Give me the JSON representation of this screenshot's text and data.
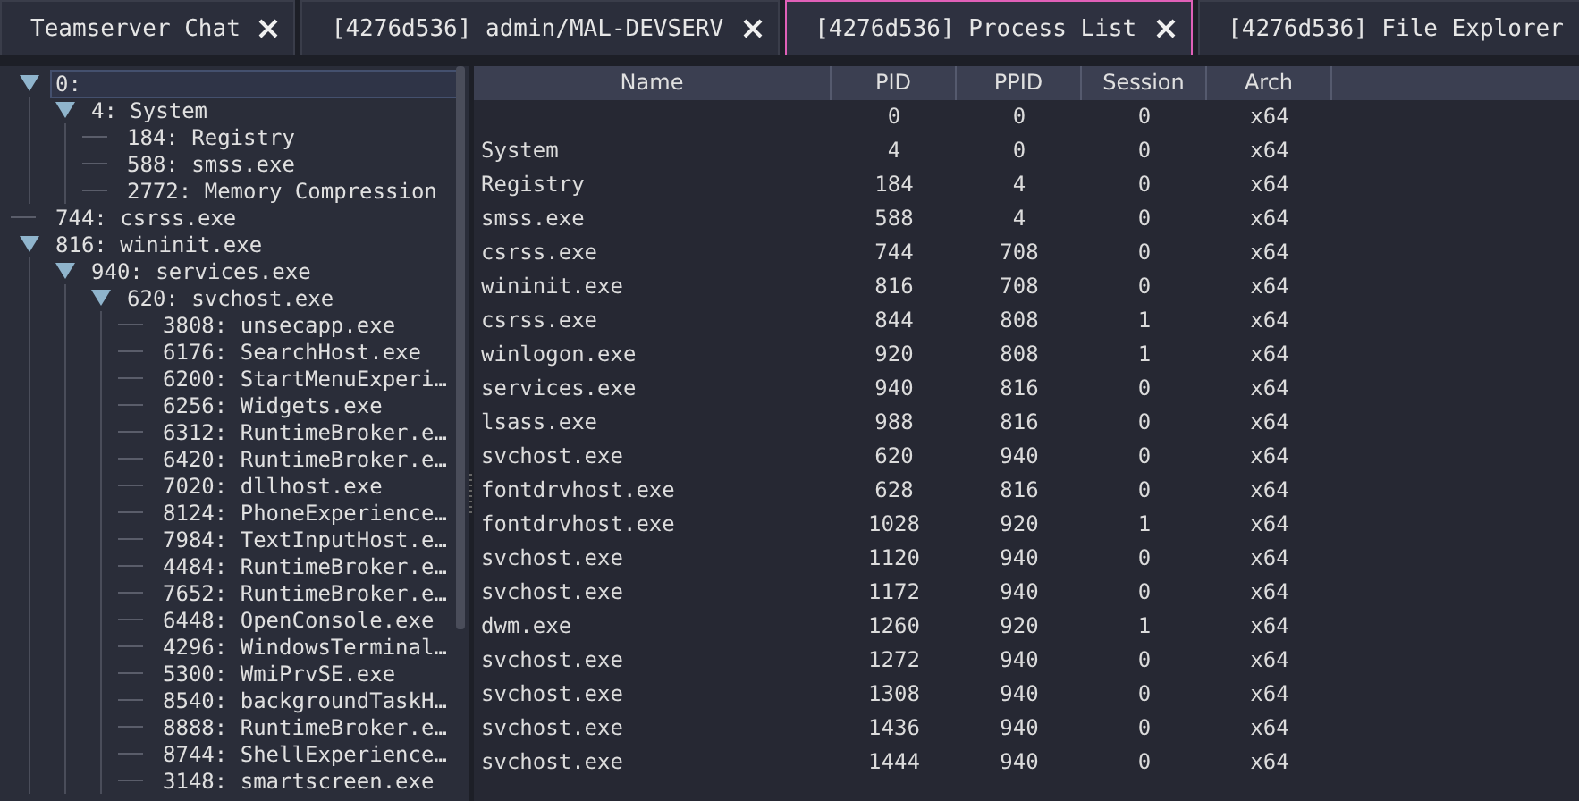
{
  "tabs": [
    {
      "label": "Teamserver Chat",
      "selected": false
    },
    {
      "label": "[4276d536] admin/MAL-DEVSERV",
      "selected": false
    },
    {
      "label": "[4276d536] Process List",
      "selected": true
    },
    {
      "label": "[4276d536] File Explorer",
      "selected": false
    }
  ],
  "process_tree": [
    {
      "label": "0:",
      "selected": true,
      "expanded": true,
      "children": [
        {
          "label": "4: System",
          "selected": false,
          "expanded": true,
          "children": [
            {
              "label": "184: Registry",
              "selected": false
            },
            {
              "label": "588: smss.exe",
              "selected": false
            },
            {
              "label": "2772: Memory Compression",
              "selected": false
            }
          ]
        }
      ]
    },
    {
      "label": "744: csrss.exe",
      "selected": false
    },
    {
      "label": "816: wininit.exe",
      "selected": false,
      "expanded": true,
      "children": [
        {
          "label": "940: services.exe",
          "selected": false,
          "expanded": true,
          "children": [
            {
              "label": "620: svchost.exe",
              "selected": false,
              "expanded": true,
              "children": [
                {
                  "label": "3808: unsecapp.exe",
                  "selected": false
                },
                {
                  "label": "6176: SearchHost.exe",
                  "selected": false
                },
                {
                  "label": "6200: StartMenuExperi…",
                  "selected": false
                },
                {
                  "label": "6256: Widgets.exe",
                  "selected": false
                },
                {
                  "label": "6312: RuntimeBroker.e…",
                  "selected": false
                },
                {
                  "label": "6420: RuntimeBroker.e…",
                  "selected": false
                },
                {
                  "label": "7020: dllhost.exe",
                  "selected": false
                },
                {
                  "label": "8124: PhoneExperience…",
                  "selected": false
                },
                {
                  "label": "7984: TextInputHost.e…",
                  "selected": false
                },
                {
                  "label": "4484: RuntimeBroker.e…",
                  "selected": false
                },
                {
                  "label": "7652: RuntimeBroker.e…",
                  "selected": false
                },
                {
                  "label": "6448: OpenConsole.exe",
                  "selected": false
                },
                {
                  "label": "4296: WindowsTerminal…",
                  "selected": false
                },
                {
                  "label": "5300: WmiPrvSE.exe",
                  "selected": false
                },
                {
                  "label": "8540: backgroundTaskH…",
                  "selected": false
                },
                {
                  "label": "8888: RuntimeBroker.e…",
                  "selected": false
                },
                {
                  "label": "8744: ShellExperience…",
                  "selected": false
                },
                {
                  "label": "3148: smartscreen.exe",
                  "selected": false
                }
              ]
            }
          ]
        }
      ]
    }
  ],
  "table": {
    "columns": [
      "Name",
      "PID",
      "PPID",
      "Session",
      "Arch"
    ],
    "rows": [
      {
        "pid": "0",
        "ppid": "0",
        "session": "0",
        "arch": "x64"
      },
      {
        "name": "System",
        "pid": "4",
        "ppid": "0",
        "session": "0",
        "arch": "x64"
      },
      {
        "name": "Registry",
        "pid": "184",
        "ppid": "4",
        "session": "0",
        "arch": "x64"
      },
      {
        "name": "smss.exe",
        "pid": "588",
        "ppid": "4",
        "session": "0",
        "arch": "x64"
      },
      {
        "name": "csrss.exe",
        "pid": "744",
        "ppid": "708",
        "session": "0",
        "arch": "x64"
      },
      {
        "name": "wininit.exe",
        "pid": "816",
        "ppid": "708",
        "session": "0",
        "arch": "x64"
      },
      {
        "name": "csrss.exe",
        "pid": "844",
        "ppid": "808",
        "session": "1",
        "arch": "x64"
      },
      {
        "name": "winlogon.exe",
        "pid": "920",
        "ppid": "808",
        "session": "1",
        "arch": "x64"
      },
      {
        "name": "services.exe",
        "pid": "940",
        "ppid": "816",
        "session": "0",
        "arch": "x64"
      },
      {
        "name": "lsass.exe",
        "pid": "988",
        "ppid": "816",
        "session": "0",
        "arch": "x64"
      },
      {
        "name": "svchost.exe",
        "pid": "620",
        "ppid": "940",
        "session": "0",
        "arch": "x64"
      },
      {
        "name": "fontdrvhost.exe",
        "pid": "628",
        "ppid": "816",
        "session": "0",
        "arch": "x64"
      },
      {
        "name": "fontdrvhost.exe",
        "pid": "1028",
        "ppid": "920",
        "session": "1",
        "arch": "x64"
      },
      {
        "name": "svchost.exe",
        "pid": "1120",
        "ppid": "940",
        "session": "0",
        "arch": "x64"
      },
      {
        "name": "svchost.exe",
        "pid": "1172",
        "ppid": "940",
        "session": "0",
        "arch": "x64"
      },
      {
        "name": "dwm.exe",
        "pid": "1260",
        "ppid": "920",
        "session": "1",
        "arch": "x64"
      },
      {
        "name": "svchost.exe",
        "pid": "1272",
        "ppid": "940",
        "session": "0",
        "arch": "x64"
      },
      {
        "name": "svchost.exe",
        "pid": "1308",
        "ppid": "940",
        "session": "0",
        "arch": "x64"
      },
      {
        "name": "svchost.exe",
        "pid": "1436",
        "ppid": "940",
        "session": "0",
        "arch": "x64"
      },
      {
        "name": "svchost.exe",
        "pid": "1444",
        "ppid": "940",
        "session": "0",
        "arch": "x64"
      }
    ]
  }
}
